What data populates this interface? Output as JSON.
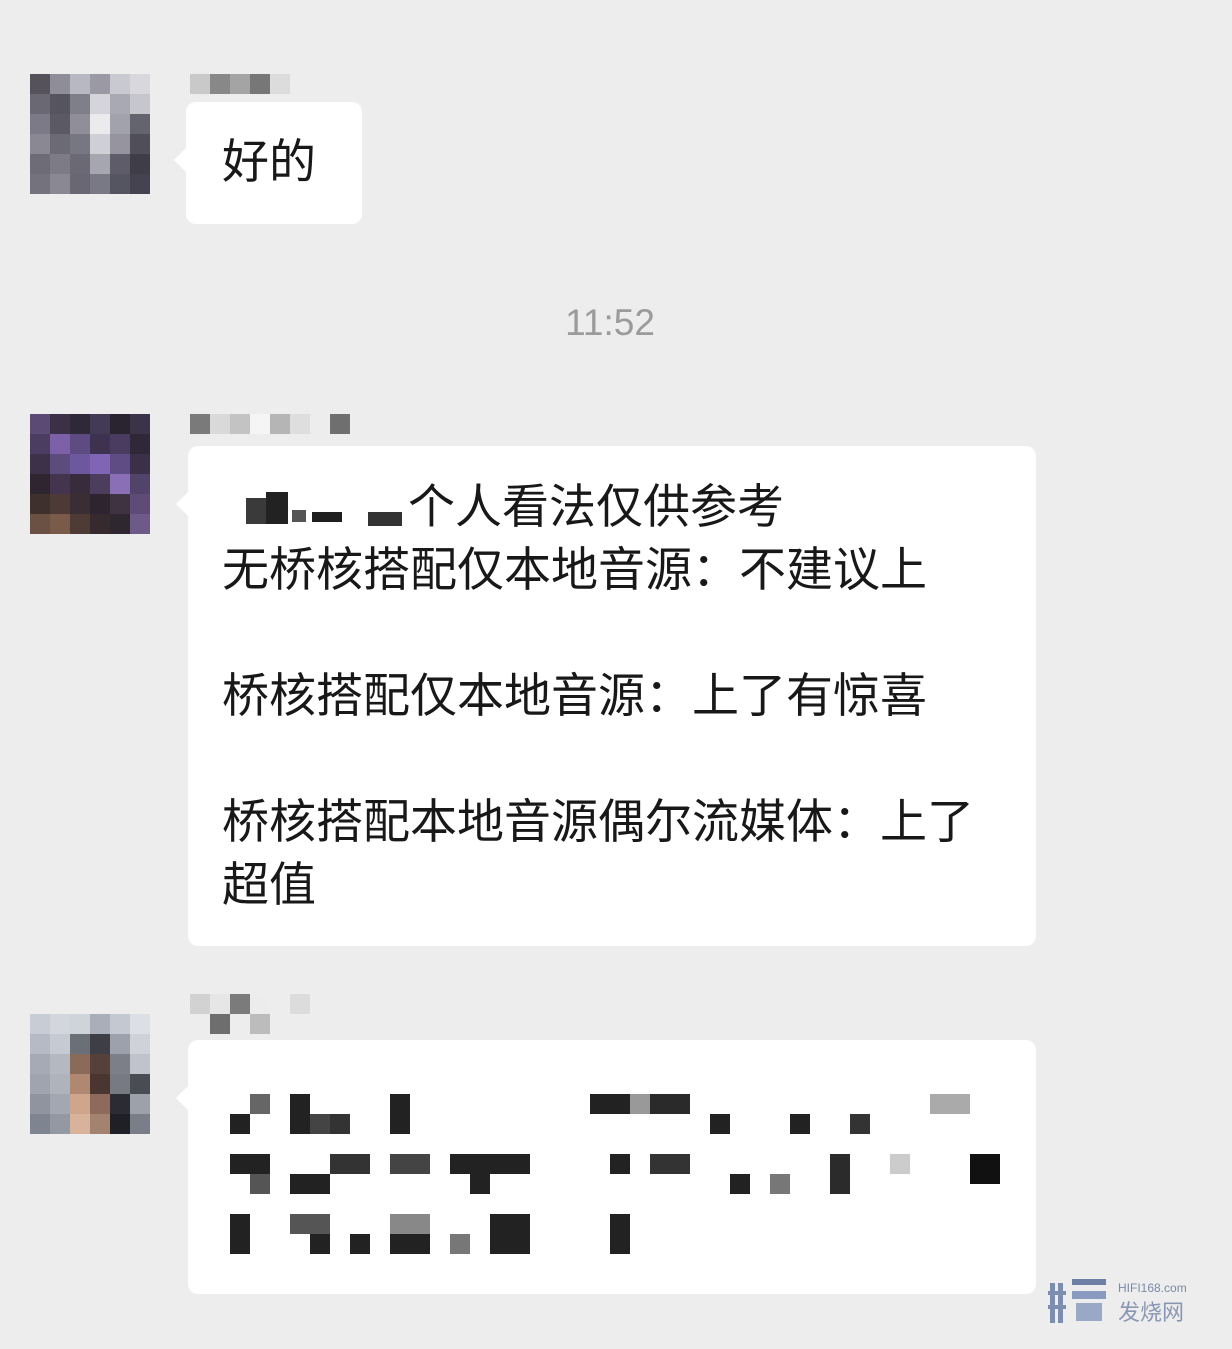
{
  "chat": {
    "timestamp": "11:52",
    "messages": [
      {
        "text": "好的"
      },
      {
        "line1": "个人看法仅供参考",
        "body": "无桥核搭配仅本地音源：不建议上\n\n桥核搭配仅本地音源：上了有惊喜\n\n桥核搭配本地音源偶尔流媒体：上了超值"
      },
      {
        "text": ""
      }
    ]
  },
  "watermark": {
    "site": "HIFI168.com",
    "label": "发烧网"
  },
  "colors": {
    "background": "#ededed",
    "bubble": "#ffffff",
    "text": "#181818",
    "timestamp": "#9b9b9b"
  }
}
